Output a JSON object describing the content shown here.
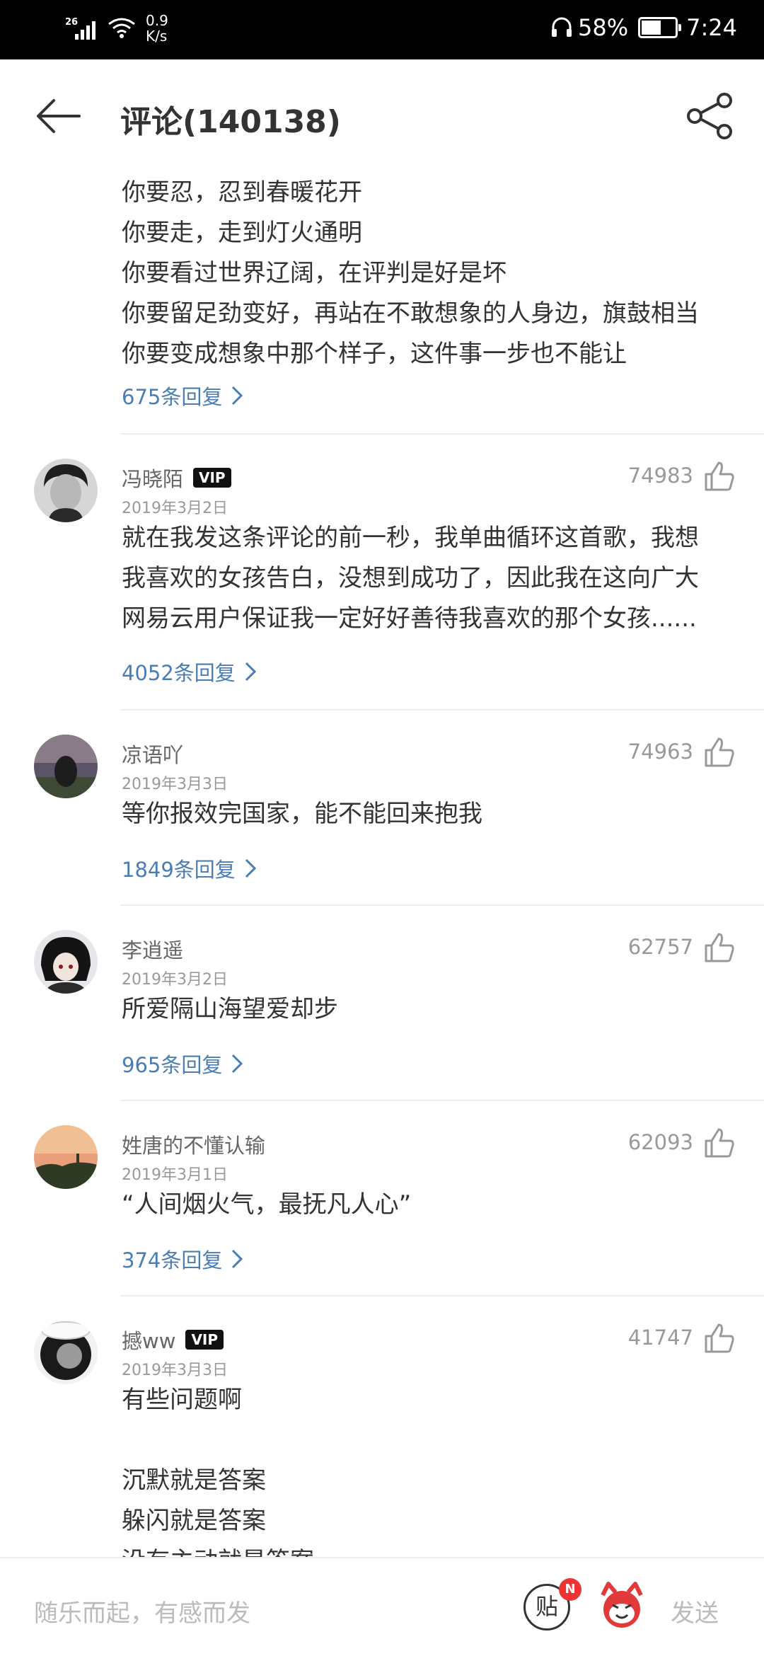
{
  "status_bar": {
    "network": "26",
    "speed": "0.9",
    "speed_unit": "K/s",
    "battery": "58%",
    "battery_level": 0.58,
    "time": "7:24"
  },
  "header": {
    "title": "评论(140138)"
  },
  "top_comment": {
    "lines": [
      "你要忍，忍到春暖花开",
      "你要走，走到灯火通明",
      "你要看过世界辽阔，在评判是好是坏",
      "你要留足劲变好，再站在不敢想象的人身边，旗鼓相当",
      "你要变成想象中那个样子，这件事一步也不能让"
    ],
    "replies": "675条回复"
  },
  "comments": [
    {
      "username": "冯晓陌",
      "vip": "VIP",
      "date": "2019年3月2日",
      "likes": "74983",
      "lines": [
        "就在我发这条评论的前一秒，我单曲循环这首歌，我想",
        "我喜欢的女孩告白，没想到成功了，因此我在这向广大",
        "网易云用户保证我一定好好善待我喜欢的那个女孩......"
      ],
      "replies": "4052条回复"
    },
    {
      "username": "凉语吖",
      "date": "2019年3月3日",
      "likes": "74963",
      "lines": [
        "等你报效完国家，能不能回来抱我"
      ],
      "replies": "1849条回复"
    },
    {
      "username": "李逍遥",
      "date": "2019年3月2日",
      "likes": "62757",
      "lines": [
        "所爱隔山海望爱却步"
      ],
      "replies": "965条回复"
    },
    {
      "username": "姓唐的不懂认输",
      "date": "2019年3月1日",
      "likes": "62093",
      "lines": [
        "“人间烟火气，最抚凡人心”"
      ],
      "replies": "374条回复"
    },
    {
      "username": "撼ww",
      "vip": "VIP",
      "date": "2019年3月3日",
      "likes": "41747",
      "lines": [
        "有些问题啊",
        "",
        "沉默就是答案",
        "躲闪就是答案",
        "没有主动就是答案"
      ]
    }
  ],
  "bottom_bar": {
    "placeholder": "随乐而起，有感而发",
    "tie_label": "贴",
    "badge": "N",
    "send": "发送"
  }
}
